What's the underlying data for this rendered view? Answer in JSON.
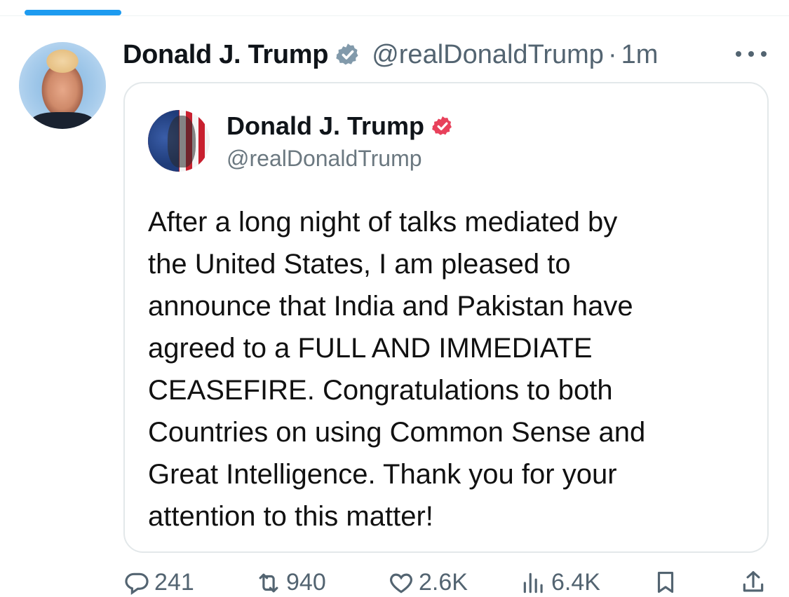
{
  "tweet": {
    "author": {
      "display_name": "Donald J. Trump",
      "handle": "@realDonaldTrump",
      "separator": "·",
      "time": "1m"
    },
    "quoted_post": {
      "display_name": "Donald J. Trump",
      "handle": "@realDonaldTrump",
      "body_lines": [
        "After a long night of talks mediated by",
        "the United States, I am pleased to",
        "announce that India and Pakistan have",
        "agreed to a FULL AND IMMEDIATE",
        "CEASEFIRE. Congratulations to both",
        "Countries on using Common Sense and",
        "Great Intelligence. Thank you for your",
        "attention to this matter!"
      ]
    },
    "actions": {
      "replies": "241",
      "reposts": "940",
      "likes": "2.6K",
      "views": "6.4K"
    }
  },
  "icons": {
    "verified": "verified-badge-icon",
    "more": "more-horizontal-icon",
    "reply": "reply-icon",
    "repost": "repost-icon",
    "like": "heart-icon",
    "views": "views-chart-icon",
    "bookmark": "bookmark-icon",
    "share": "share-icon"
  },
  "colors": {
    "accent": "#1d9bf0",
    "verified_gray": "#829aab",
    "quoted_verified": "#e8415b",
    "secondary_text": "#536471"
  }
}
